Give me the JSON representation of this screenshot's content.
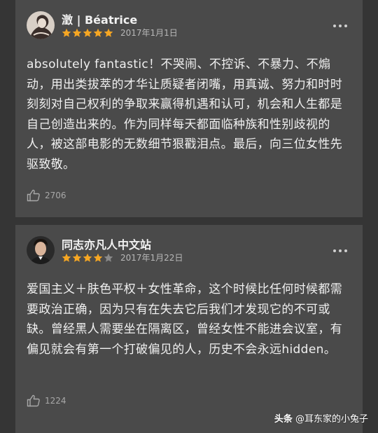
{
  "colors": {
    "page_bg": "#353535",
    "panel_bg": "#4a4a4a",
    "star_filled": "#f5a623",
    "star_empty": "#8a8a8a",
    "meta_text": "#b8b8b8"
  },
  "reviews": [
    {
      "username": "澂 | Béatrice",
      "avatar_icon": "avatar-sketch-portrait",
      "rating": 5,
      "max_rating": 5,
      "date": "2017年1月1日",
      "content": "absolutely fantastic！不哭闹、不控诉、不暴力、不煽动，用出类拔萃的才华让质疑者闭嘴，用真诚、努力和时时刻刻对自己权利的争取来赢得机遇和认可，机会和人生都是自己创造出来的。作为同样每天都面临种族和性别歧视的人，被这部电影的无数细节狠戳泪点。最后，向三位女性先驱致敬。",
      "likes": "2706"
    },
    {
      "username": "同志亦凡人中文站",
      "avatar_icon": "avatar-man-portrait",
      "rating": 4,
      "max_rating": 5,
      "date": "2017年1月22日",
      "content": "爱国主义＋肤色平权＋女性革命，这个时候比任何时候都需要政治正确，因为只有在失去它后我们才发现它的不可或缺。曾经黑人需要坐在隔离区，曾经女性不能进会议室，有偏见就会有第一个打破偏见的人，历史不会永远hidden。",
      "likes": "1224"
    }
  ],
  "watermark": {
    "brand": "头条",
    "handle": "@耳东家的小兔子"
  }
}
